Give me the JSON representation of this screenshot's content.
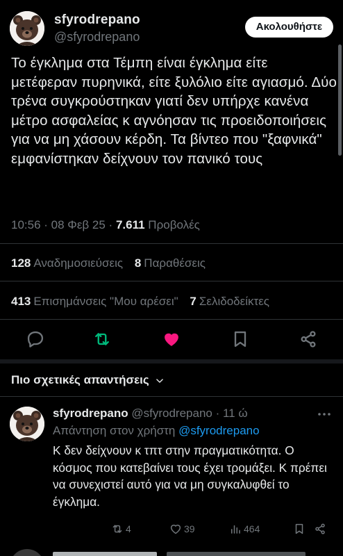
{
  "tweet": {
    "author_name": "sfyrodrepano",
    "author_handle": "@sfyrodrepano",
    "follow_label": "Ακολουθήστε",
    "text": "Το έγκλημα στα Τέμπη είναι έγκλημα είτε μετέφεραν πυρηνικά, είτε ξυλόλιο είτε αγιασμό. Δύο τρένα συγκρούστηκαν γιατί δεν υπήρχε κανένα μέτρο ασφαλείας κ αγνόησαν τις προειδοποιήσεις για να μη χάσουν κέρδη. Τα βίντεο που \"ξαφνικά\" εμφανίστηκαν δείχνουν τον πανικό τους",
    "time": "10:56 · 08 Φεβ 25 · ",
    "views_count": "7.611",
    "views_label": " Προβολές"
  },
  "stats": {
    "reposts_count": "128",
    "reposts_label": "Αναδημοσιεύσεις",
    "quotes_count": "8",
    "quotes_label": "Παραθέσεις",
    "likes_count": "413",
    "likes_label": "Επισημάνσεις \"Μου αρέσει\"",
    "bookmarks_count": "7",
    "bookmarks_label": "Σελιδοδείκτες"
  },
  "actions": {
    "icons": [
      "reply-icon",
      "repost-icon",
      "like-icon",
      "bookmark-icon",
      "share-icon"
    ],
    "repost_color": "#00ba7c",
    "like_color": "#f91880"
  },
  "replies_section": {
    "title": "Πιο σχετικές απαντήσεις"
  },
  "reply": {
    "author_name": "sfyrodrepano",
    "author_handle": "@sfyrodrepano",
    "time": " · 11 ώ",
    "reply_to_label": "Απάντηση στον χρήστη ",
    "reply_to_handle": "@sfyrodrepano",
    "text": "Κ δεν δείχνουν κ τπτ στην πραγματικότητα. Ο κόσμος που κατεβαίνει τους έχει τρομάξει. Κ πρέπει να συνεχιστεί αυτό για να μη συγκαλυφθεί το έγκλημα.",
    "reposts": "4",
    "likes": "39",
    "views": "464"
  }
}
